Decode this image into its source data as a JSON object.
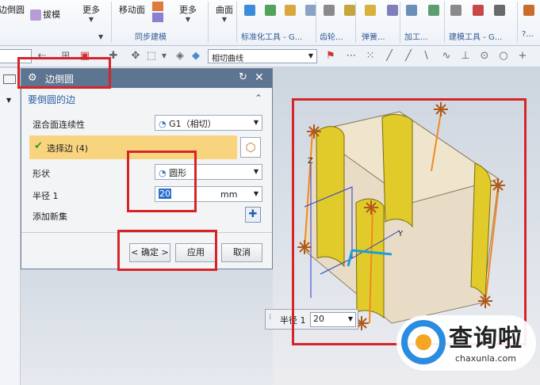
{
  "ribbon": {
    "edge_blend": "边倒圆",
    "sweep": "拔模",
    "more1": "更多",
    "move_face": "移动面",
    "more2": "更多",
    "curve": "曲面",
    "more3": "更多",
    "group_sync": "同步建模",
    "group_std": "标准化工具 - G...",
    "group_gear": "齿轮...",
    "group_spring": "弹簧...",
    "group_machining": "加工...",
    "group_build": "建模工具 - G...",
    "group_more": "?..."
  },
  "toolbar2": {
    "curve_rule": "相切曲线"
  },
  "dialog": {
    "title": "边倒圆",
    "section_title": "要倒圆的边",
    "blend_continuity_label": "混合面连续性",
    "blend_continuity_value": "G1（相切）",
    "select_edge_label": "选择边 (4)",
    "shape_label": "形状",
    "shape_value": "圆形",
    "radius_label": "半径 1",
    "radius_value": "20",
    "radius_unit": "mm",
    "add_new_set_label": "添加新集",
    "ok_label": "< 确定 >",
    "apply_label": "应用",
    "cancel_label": "取消"
  },
  "viewport": {
    "onscreen_label": "半径 1",
    "onscreen_value": "20",
    "axis_y": "Y",
    "axis_z": "Z"
  },
  "watermark": {
    "brand": "查询啦",
    "url": "chaxunla.com"
  },
  "colors": {
    "highlight_red": "#d5252a",
    "dialog_title_bg": "#5d7591",
    "selection_row_bg": "#f9d47e",
    "surface_yellow": "#e0cb2a"
  }
}
